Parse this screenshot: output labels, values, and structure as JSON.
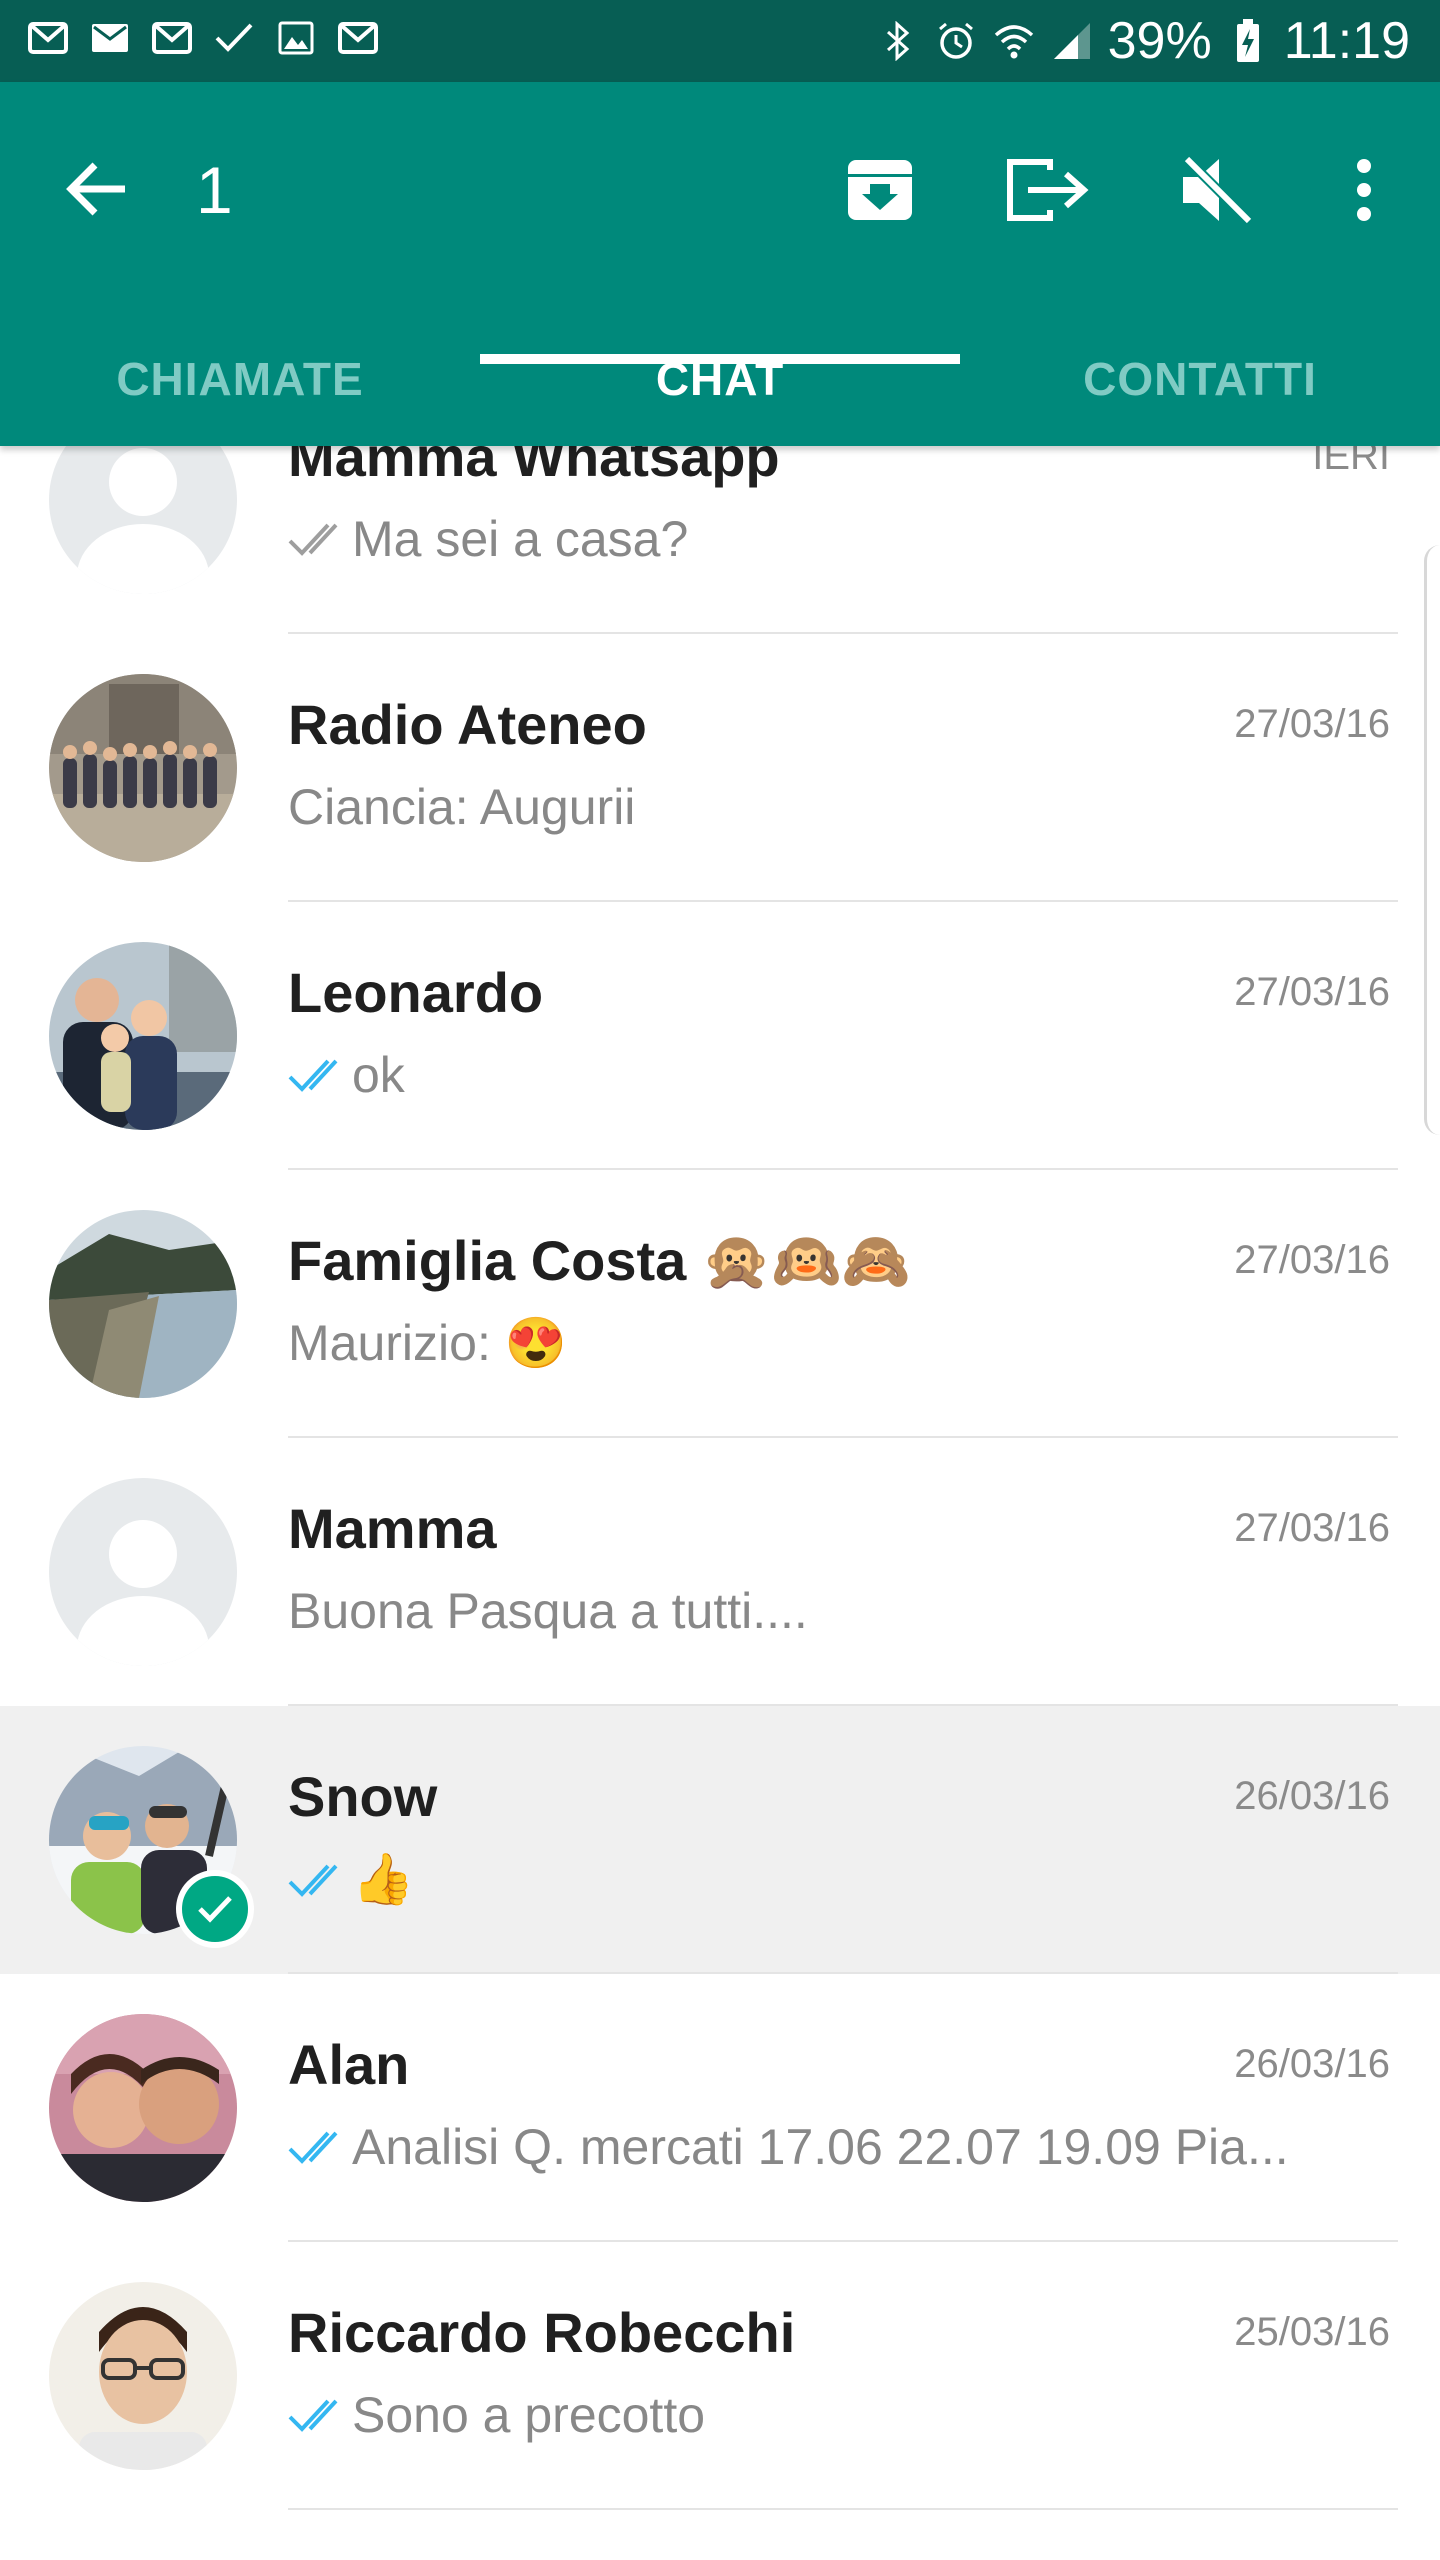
{
  "status_bar": {
    "left_icons": [
      "gmail-icon",
      "mail-icon",
      "gmail-icon",
      "check-icon",
      "image-icon",
      "gmail-icon"
    ],
    "right_icons": [
      "bluetooth-icon",
      "alarm-icon",
      "wifi-icon",
      "signal-icon"
    ],
    "battery": "39%",
    "time": "11:19"
  },
  "appbar": {
    "selected_count": "1",
    "actions": [
      "archive-icon",
      "exit-icon",
      "mute-icon",
      "more-vert-icon"
    ],
    "color": "#00897B"
  },
  "tabs": [
    {
      "label": "CHIAMATE",
      "active": false
    },
    {
      "label": "CHAT",
      "active": true
    },
    {
      "label": "CONTATTI",
      "active": false
    }
  ],
  "chats": [
    {
      "name": "Mamma Whatsapp",
      "date": "IERI",
      "ticks": "grey",
      "preview": "Ma sei a casa?",
      "avatar": "placeholder",
      "selected": false
    },
    {
      "name": "Radio Ateneo",
      "date": "27/03/16",
      "ticks": "none",
      "preview": "Ciancia: Augurii",
      "avatar": "group-photo",
      "selected": false
    },
    {
      "name": "Leonardo",
      "date": "27/03/16",
      "ticks": "blue",
      "preview": "ok",
      "avatar": "family-photo",
      "selected": false
    },
    {
      "name": "Famiglia Costa 🙊🙉🙈",
      "date": "27/03/16",
      "ticks": "none",
      "preview": "Maurizio: 😍",
      "avatar": "coast-photo",
      "selected": false
    },
    {
      "name": "Mamma",
      "date": "27/03/16",
      "ticks": "none",
      "preview": "Buona Pasqua a tutti....",
      "avatar": "placeholder",
      "selected": false
    },
    {
      "name": "Snow",
      "date": "26/03/16",
      "ticks": "blue",
      "preview": "👍",
      "avatar": "snow-photo",
      "selected": true
    },
    {
      "name": "Alan",
      "date": "26/03/16",
      "ticks": "blue",
      "preview": "Analisi Q. mercati   17.06 22.07 19.09 Pia...",
      "avatar": "couple-photo",
      "selected": false
    },
    {
      "name": "Riccardo Robecchi",
      "date": "25/03/16",
      "ticks": "blue",
      "preview": "Sono a precotto",
      "avatar": "portrait-photo",
      "selected": false
    }
  ]
}
